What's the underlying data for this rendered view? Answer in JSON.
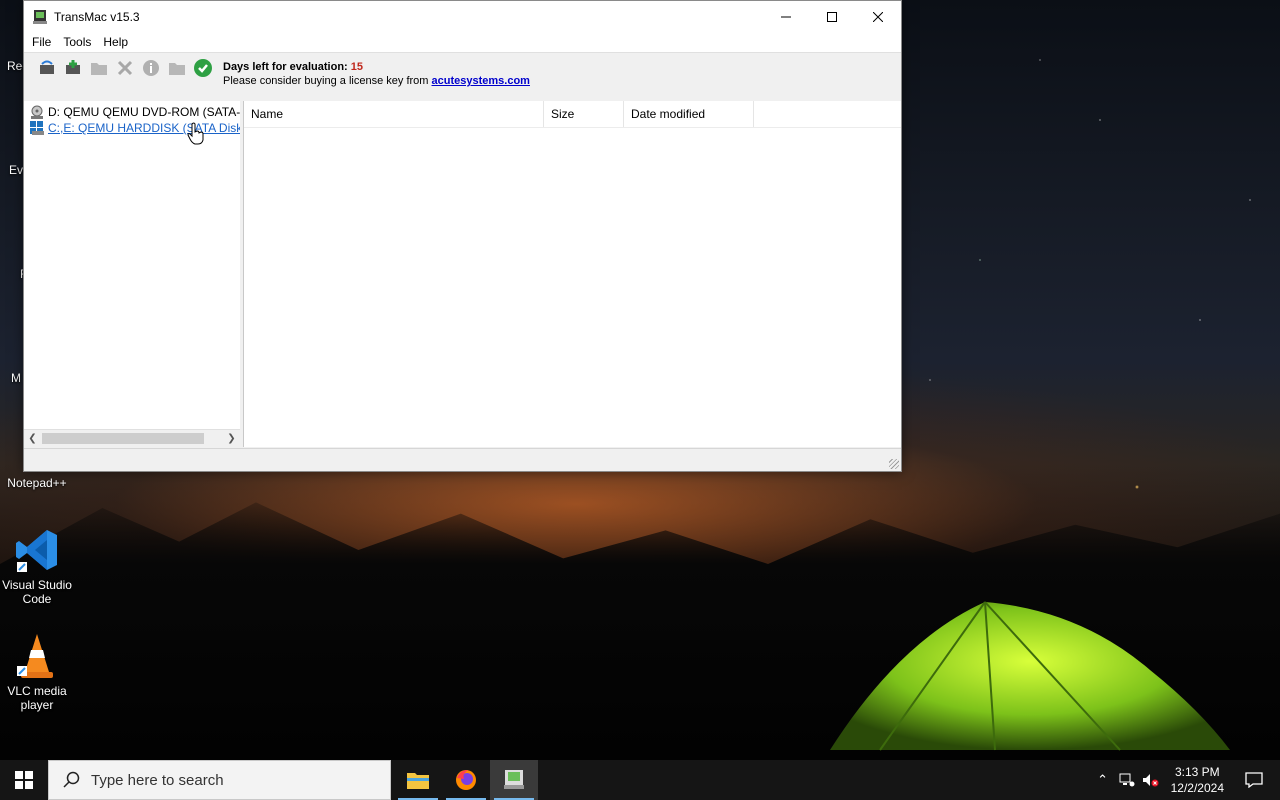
{
  "window": {
    "title": "TransMac v15.3",
    "menus": [
      "File",
      "Tools",
      "Help"
    ],
    "eval_label": "Days left for evaluation:",
    "eval_days": "15",
    "license_text": "Please consider buying a license key from",
    "license_link": "acutesystems.com",
    "tree": [
      {
        "label": "D: QEMU QEMU DVD-ROM (SATA-CdRom)",
        "icon": "dvd-drive-icon"
      },
      {
        "label": "C:,E:  QEMU HARDDISK (SATA Disk)",
        "icon": "hard-disk-icon"
      }
    ],
    "columns": [
      "Name",
      "Size",
      "Date modified"
    ]
  },
  "desktop": {
    "icons": [
      {
        "label": "Notepad++"
      },
      {
        "label": "Visual Studio Code"
      },
      {
        "label": "VLC media player"
      }
    ],
    "partial_labels": [
      "Rec",
      "Ev",
      "F",
      "M"
    ]
  },
  "taskbar": {
    "search_placeholder": "Type here to search",
    "time": "3:13 PM",
    "date": "12/2/2024"
  },
  "colors": {
    "eval_days": "#c0281d",
    "link": "#0000cc",
    "highlight_link": "#1a63c8"
  }
}
